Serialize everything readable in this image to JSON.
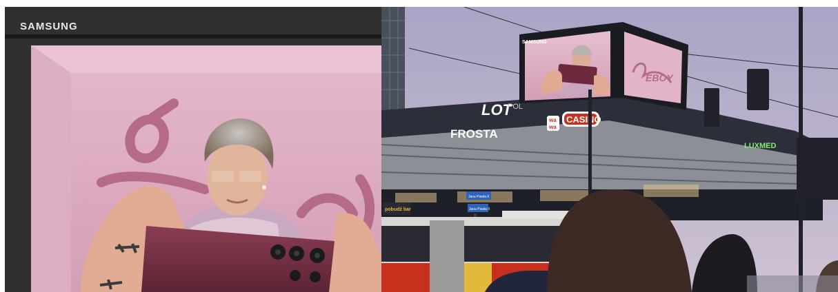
{
  "left_panel": {
    "brand_text": "SAMSUNG",
    "wall_graffiti": "BOY"
  },
  "right_panel": {
    "billboard_brand": "SAMSUNG",
    "billboard_graffiti": "ÉBOY",
    "signs": {
      "lot": "LOT",
      "lot_suffix": "POL",
      "frosta": "FROSTA",
      "wawa_top": "wa",
      "wawa_bottom": "wa",
      "casino": "CASINO",
      "luxmed": "LUXMED",
      "street_sign_1": "Jana Pawła II",
      "street_sign_2": "Jana Pawła II",
      "shop_sign": "pobudź bar"
    }
  },
  "colors": {
    "pink_wall": "#d9a7bd",
    "phone": "#7a3346",
    "sky": "#b8b2cc",
    "bus_red": "#c8301e",
    "bus_yellow": "#e2b93b"
  }
}
